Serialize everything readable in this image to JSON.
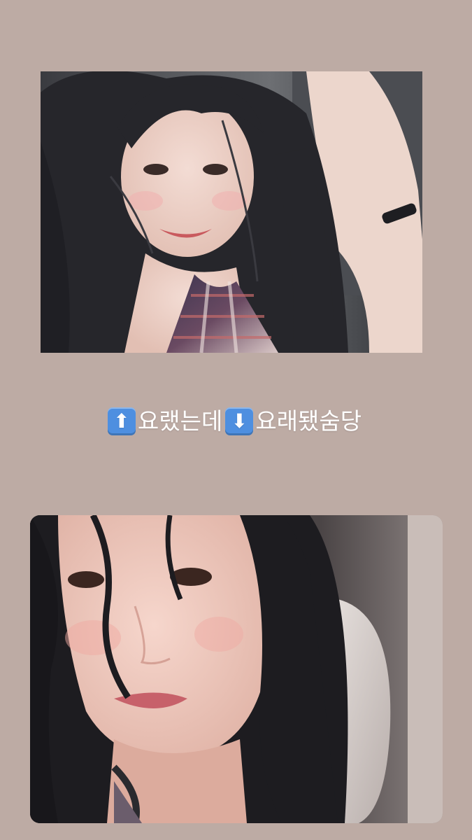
{
  "story": {
    "background_color": "#bdaba4",
    "caption": {
      "up_icon_name": "up-arrow-emoji-icon",
      "up_glyph": "⬆",
      "text_1": "요랬는데",
      "down_icon_name": "down-arrow-emoji-icon",
      "down_glyph": "⬇",
      "text_2": "요래됐숨당",
      "text_color": "#ffffff",
      "emoji_color": "#4e8fe0"
    },
    "photos": [
      {
        "name": "photo-top"
      },
      {
        "name": "photo-bottom"
      }
    ]
  }
}
